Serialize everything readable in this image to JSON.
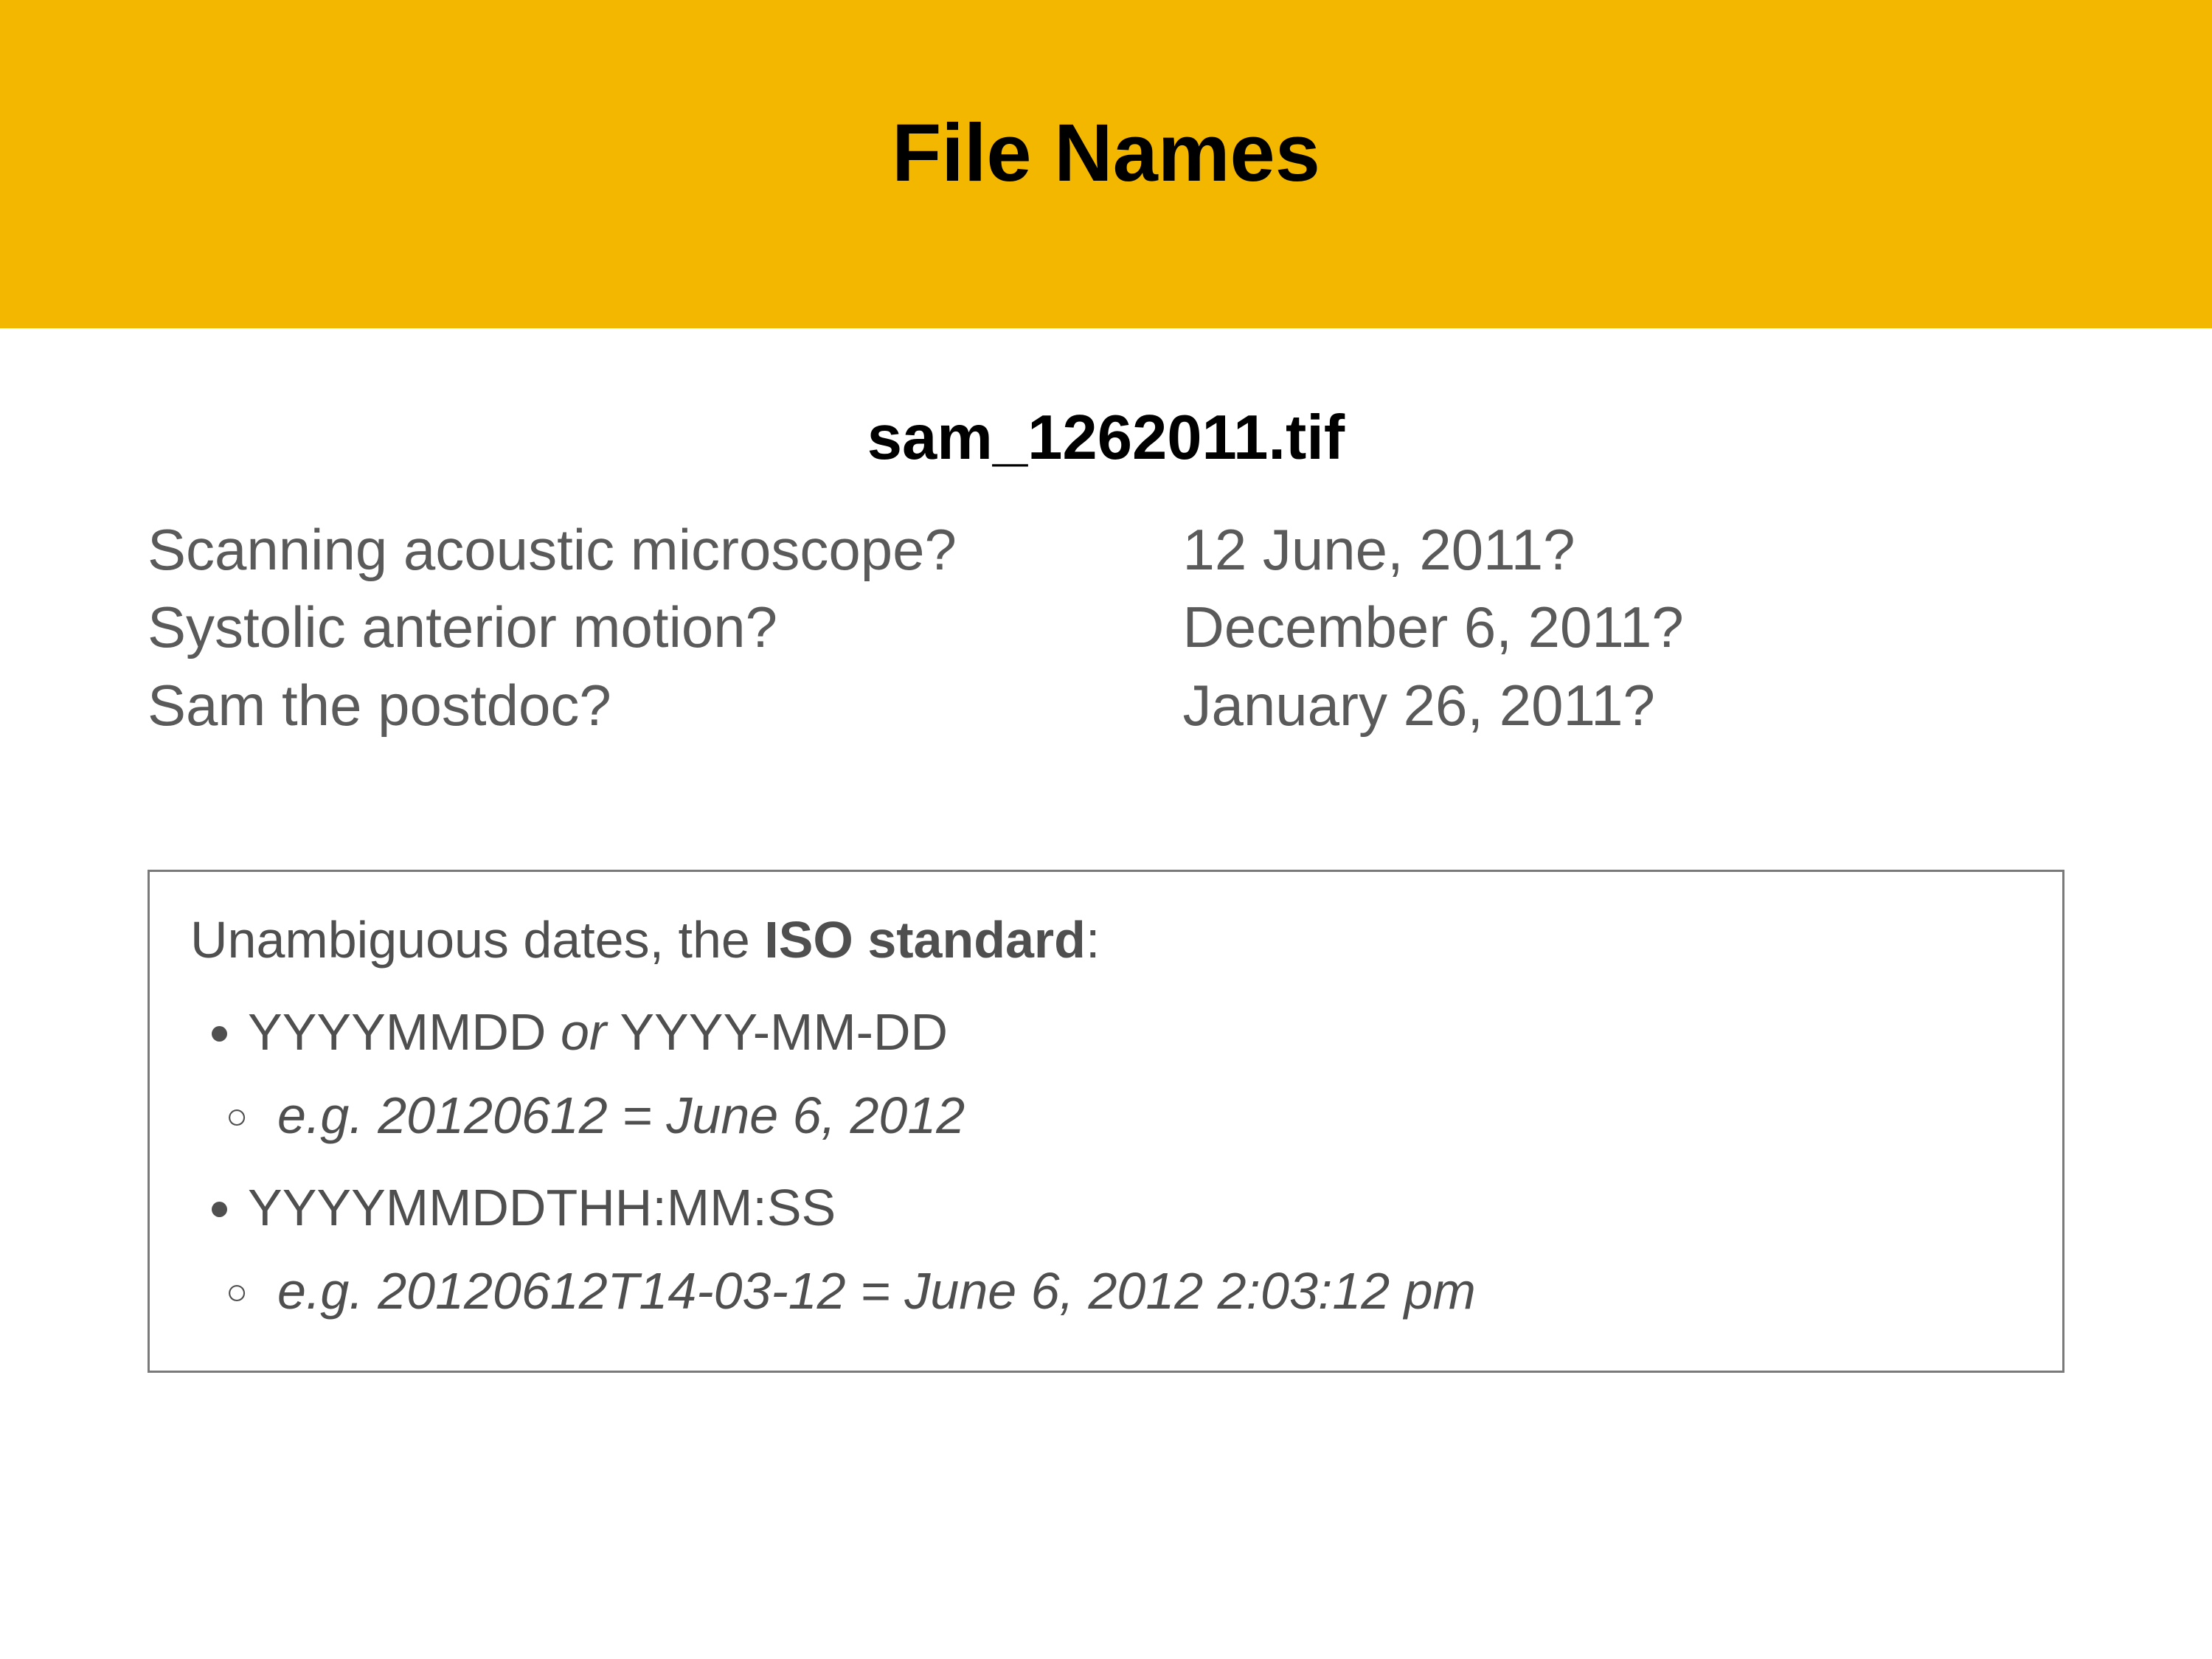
{
  "header": {
    "title": "File Names"
  },
  "filename": "sam_1262011.tif",
  "left_items": [
    "Scanning acoustic microscope?",
    "Systolic anterior motion?",
    "Sam the postdoc?"
  ],
  "right_items": [
    "12 June, 2011?",
    "December 6, 2011?",
    "January 26, 2011?"
  ],
  "iso": {
    "heading_pre": "Unambiguous dates, the ",
    "heading_bold": "ISO standard",
    "heading_post": ":",
    "items": [
      {
        "line_pre": "YYYYMMDD  ",
        "line_italic": "or",
        "line_post": "  YYYY-MM-DD",
        "sub": "e.g. 20120612 = June 6, 2012"
      },
      {
        "line_pre": "YYYYMMDDTHH:MM:SS",
        "line_italic": "",
        "line_post": "",
        "sub": "e.g. 20120612T14-03-12 = June 6, 2012 2:03:12 pm"
      }
    ]
  }
}
